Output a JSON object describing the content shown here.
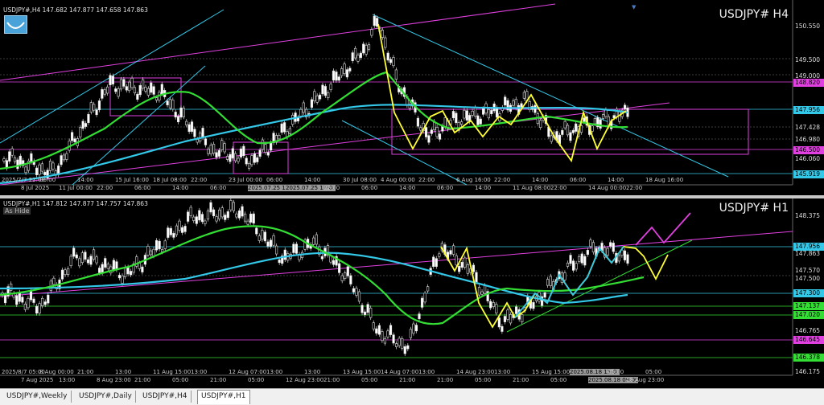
{
  "panes": {
    "h4": {
      "ohlc_text": "USDJPY#,H4  147.682 147.877 147.658 147.863",
      "symbol_label": "USDJPY# H4",
      "price_labels": [
        "150.550",
        "149.500",
        "149.000",
        "148.820",
        "147.956",
        "147.428",
        "146.980",
        "146.500",
        "146.060",
        "145.919"
      ],
      "time_labels": [
        "2025/7/7 22:00",
        "8 Jul 2025",
        "06:00",
        "11 Jul 00:00",
        "14:00",
        "22:00",
        "15 Jul 16:00",
        "06:00",
        "18 Jul 08:00",
        "14:00",
        "22:00",
        "06:00",
        "23 Jul 00:00",
        "2025.07.25 18:00",
        "06:00",
        "2025.07.25 12:00",
        "14:00",
        "22:00",
        "30 Jul 08:00",
        "06:00",
        "4 Aug 00:00",
        "14:00",
        "22:00",
        "06:00",
        "6 Aug 16:00",
        "14:00",
        "22:00",
        "11 Aug 08:00",
        "14:00",
        "22:00",
        "06:00",
        "14 Aug 00:00",
        "14:00",
        "22:00",
        "18 Aug 16:00"
      ]
    },
    "h1": {
      "ohlc_text": "USDJPY#,H1  147.812 147.877 147.757 147.863",
      "ai_hide_label": "As Hide",
      "symbol_label": "USDJPY# H1",
      "price_labels": [
        "148.375",
        "147.956",
        "147.863",
        "147.570",
        "147.500",
        "147.300",
        "147.137",
        "147.020",
        "146.765",
        "146.645",
        "146.378",
        "146.175"
      ],
      "time_labels": [
        "2025/8/7 05:00",
        "7 Aug 2025",
        "8 Aug 00:00",
        "13:00",
        "21:00",
        "8 Aug 23:00",
        "13:00",
        "21:00",
        "11 Aug 15:00",
        "05:00",
        "13:00",
        "21:00",
        "12 Aug 07:00",
        "05:00",
        "13:00",
        "12 Aug 23:00",
        "13:00",
        "21:00",
        "13 Aug 15:00",
        "05:00",
        "14 Aug 07:00",
        "21:00",
        "13:00",
        "21:00",
        "14 Aug 23:00",
        "05:00",
        "13:00",
        "21:00",
        "15 Aug 15:00",
        "05:00",
        "2025.08.18 15:00",
        "2025.08.18 09:00",
        "05:00",
        "18 Aug 23:00",
        "05:00"
      ]
    }
  },
  "tabs": [
    {
      "label": "USDJPY#,Weekly",
      "active": false
    },
    {
      "label": "USDJPY#,Daily",
      "active": false
    },
    {
      "label": "USDJPY#,H4",
      "active": false
    },
    {
      "label": "USDJPY#,H1",
      "active": true
    }
  ],
  "colors": {
    "background": "#000000",
    "bull_candle": "#ffffff",
    "bear_candle": "#000000",
    "ma_fast": "#33dd33",
    "ma_slow": "#33c8e8",
    "zigzag": "#ffff33",
    "trendline": "#33c8e8",
    "channel": "#e040e0",
    "grid": "#333333"
  }
}
